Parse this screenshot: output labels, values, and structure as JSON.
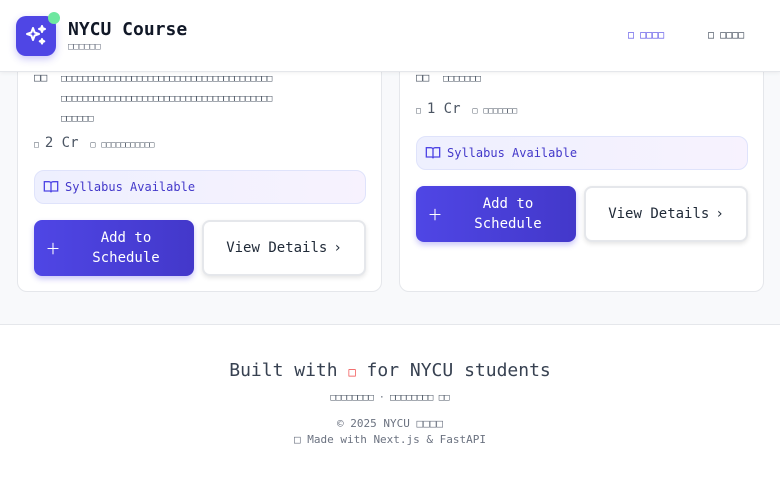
{
  "header": {
    "title": "NYCU Course",
    "subtitle": "□□□□□□",
    "nav": [
      {
        "icon": "□",
        "label": "□□□□"
      },
      {
        "icon": "□",
        "label": "□□□□"
      }
    ]
  },
  "cards": [
    {
      "schedule_icon": "□□",
      "schedule_lines": [
        "□□□□□□□□□□□□□□□□□□□□□□□□□□□□□□□□□□□□□□□",
        "□□□□□□□□□□□□□□□□□□□□□□□□□□□□□□□□□□□□□□□",
        "□□□□□□"
      ],
      "credit_icon": "□",
      "credits": "2 Cr",
      "dept_icon": "□",
      "dept": "□□□□□□□□□□□",
      "syllabus": "Syllabus Available",
      "add_label": "Add to Schedule",
      "view_label": "View Details"
    },
    {
      "schedule_icon": "□□",
      "schedule_lines": [
        "□□□□□□□"
      ],
      "credit_icon": "□",
      "credits": "1 Cr",
      "dept_icon": "□",
      "dept": "□□□□□□□",
      "syllabus": "Syllabus Available",
      "add_label": "Add to Schedule",
      "view_label": "View Details"
    }
  ],
  "footer": {
    "built_prefix": "Built with",
    "heart": "□",
    "built_suffix": "for NYCU students",
    "links": "□□□□□□□□ · □□□□□□□□ □□",
    "copyright": "© 2025 NYCU □□□□",
    "made_with": "□ Made with Next.js & FastAPI"
  },
  "colors": {
    "accent": "#4f46e5",
    "status": "#6ee7a0"
  }
}
